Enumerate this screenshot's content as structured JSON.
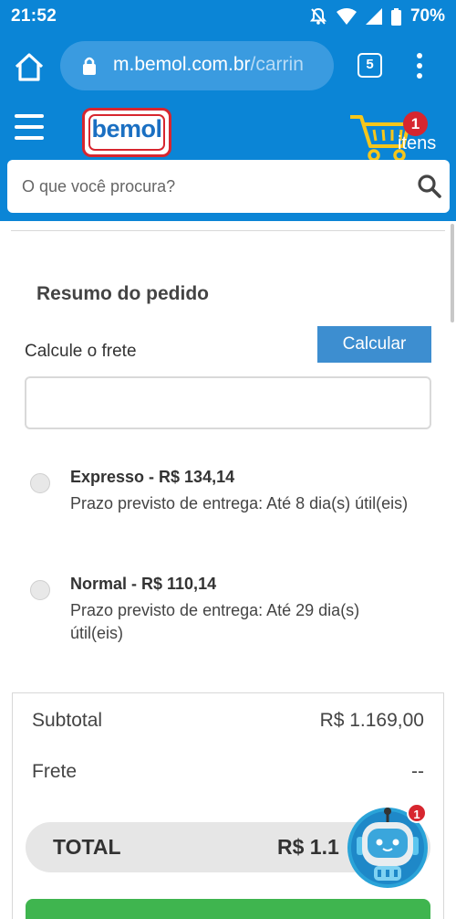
{
  "status_bar": {
    "time": "21:52",
    "battery": "70%"
  },
  "browser": {
    "url_domain": "m.bemol.com.br",
    "url_path": "/carrin",
    "tab_count": "5"
  },
  "header": {
    "logo_text": "bemol",
    "cart_count": "1",
    "cart_label": "itens",
    "search_placeholder": "O que você procura?"
  },
  "order": {
    "title": "Resumo do pedido",
    "shipping_label": "Calcule o frete",
    "calc_button": "Calcular",
    "zip_value": ""
  },
  "shipping_options": [
    {
      "title": "Expresso - R$ 134,14",
      "desc": "Prazo previsto de entrega: Até 8 dia(s) útil(eis)"
    },
    {
      "title": "Normal - R$ 110,14",
      "desc": "Prazo previsto de entrega: Até 29 dia(s) útil(eis)"
    }
  ],
  "summary": {
    "subtotal_label": "Subtotal",
    "subtotal_value": "R$ 1.169,00",
    "freight_label": "Frete",
    "freight_value": "--",
    "total_label": "TOTAL",
    "total_value": "R$ 1.1"
  },
  "chat": {
    "badge": "1"
  },
  "colors": {
    "brand_blue": "#0b85d6",
    "button_blue": "#3d8ed0",
    "badge_red": "#d7262f",
    "action_green": "#3fb54f"
  }
}
